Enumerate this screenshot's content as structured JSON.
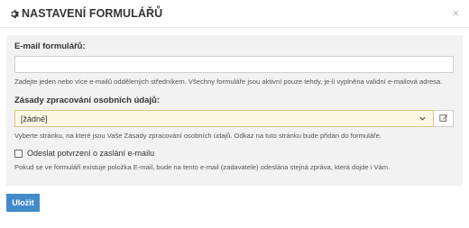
{
  "dialog": {
    "title": "NASTAVENÍ FORMULÁŘŮ",
    "title_icon": "gear-icon",
    "close_icon": "close-icon",
    "close_glyph": "×"
  },
  "form": {
    "email": {
      "label": "E-mail formulářů:",
      "value": "",
      "help": "Zadejte jeden nebo více e-mailů oddělených středníkem. Všechny formuláře jsou aktivní pouze tehdy, je-li vyplněna validní e-mailová adresa."
    },
    "privacy": {
      "label": "Zásady zpracování osobních údajů:",
      "selected": "[žádné]",
      "edit_icon": "edit-icon",
      "help": "Vyberte stránku, na které jsou Vaše Zásady zpracování osobních údajů. Odkaz na tuto stránku bude přidán do formuláře."
    },
    "confirmation": {
      "label": "Odeslat potvrzení o zaslání e-mailu",
      "checked": false,
      "help": "Pokud se ve formuláři existuje položka E-mail, bude na tento e-mail (zadavatele) odeslána stejná zpráva, která dojde i Vám."
    }
  },
  "actions": {
    "save_label": "Uložit"
  },
  "colors": {
    "primary": "#428bca",
    "select_bg": "#fcf8e3",
    "panel_bg": "#f2f2f2"
  }
}
